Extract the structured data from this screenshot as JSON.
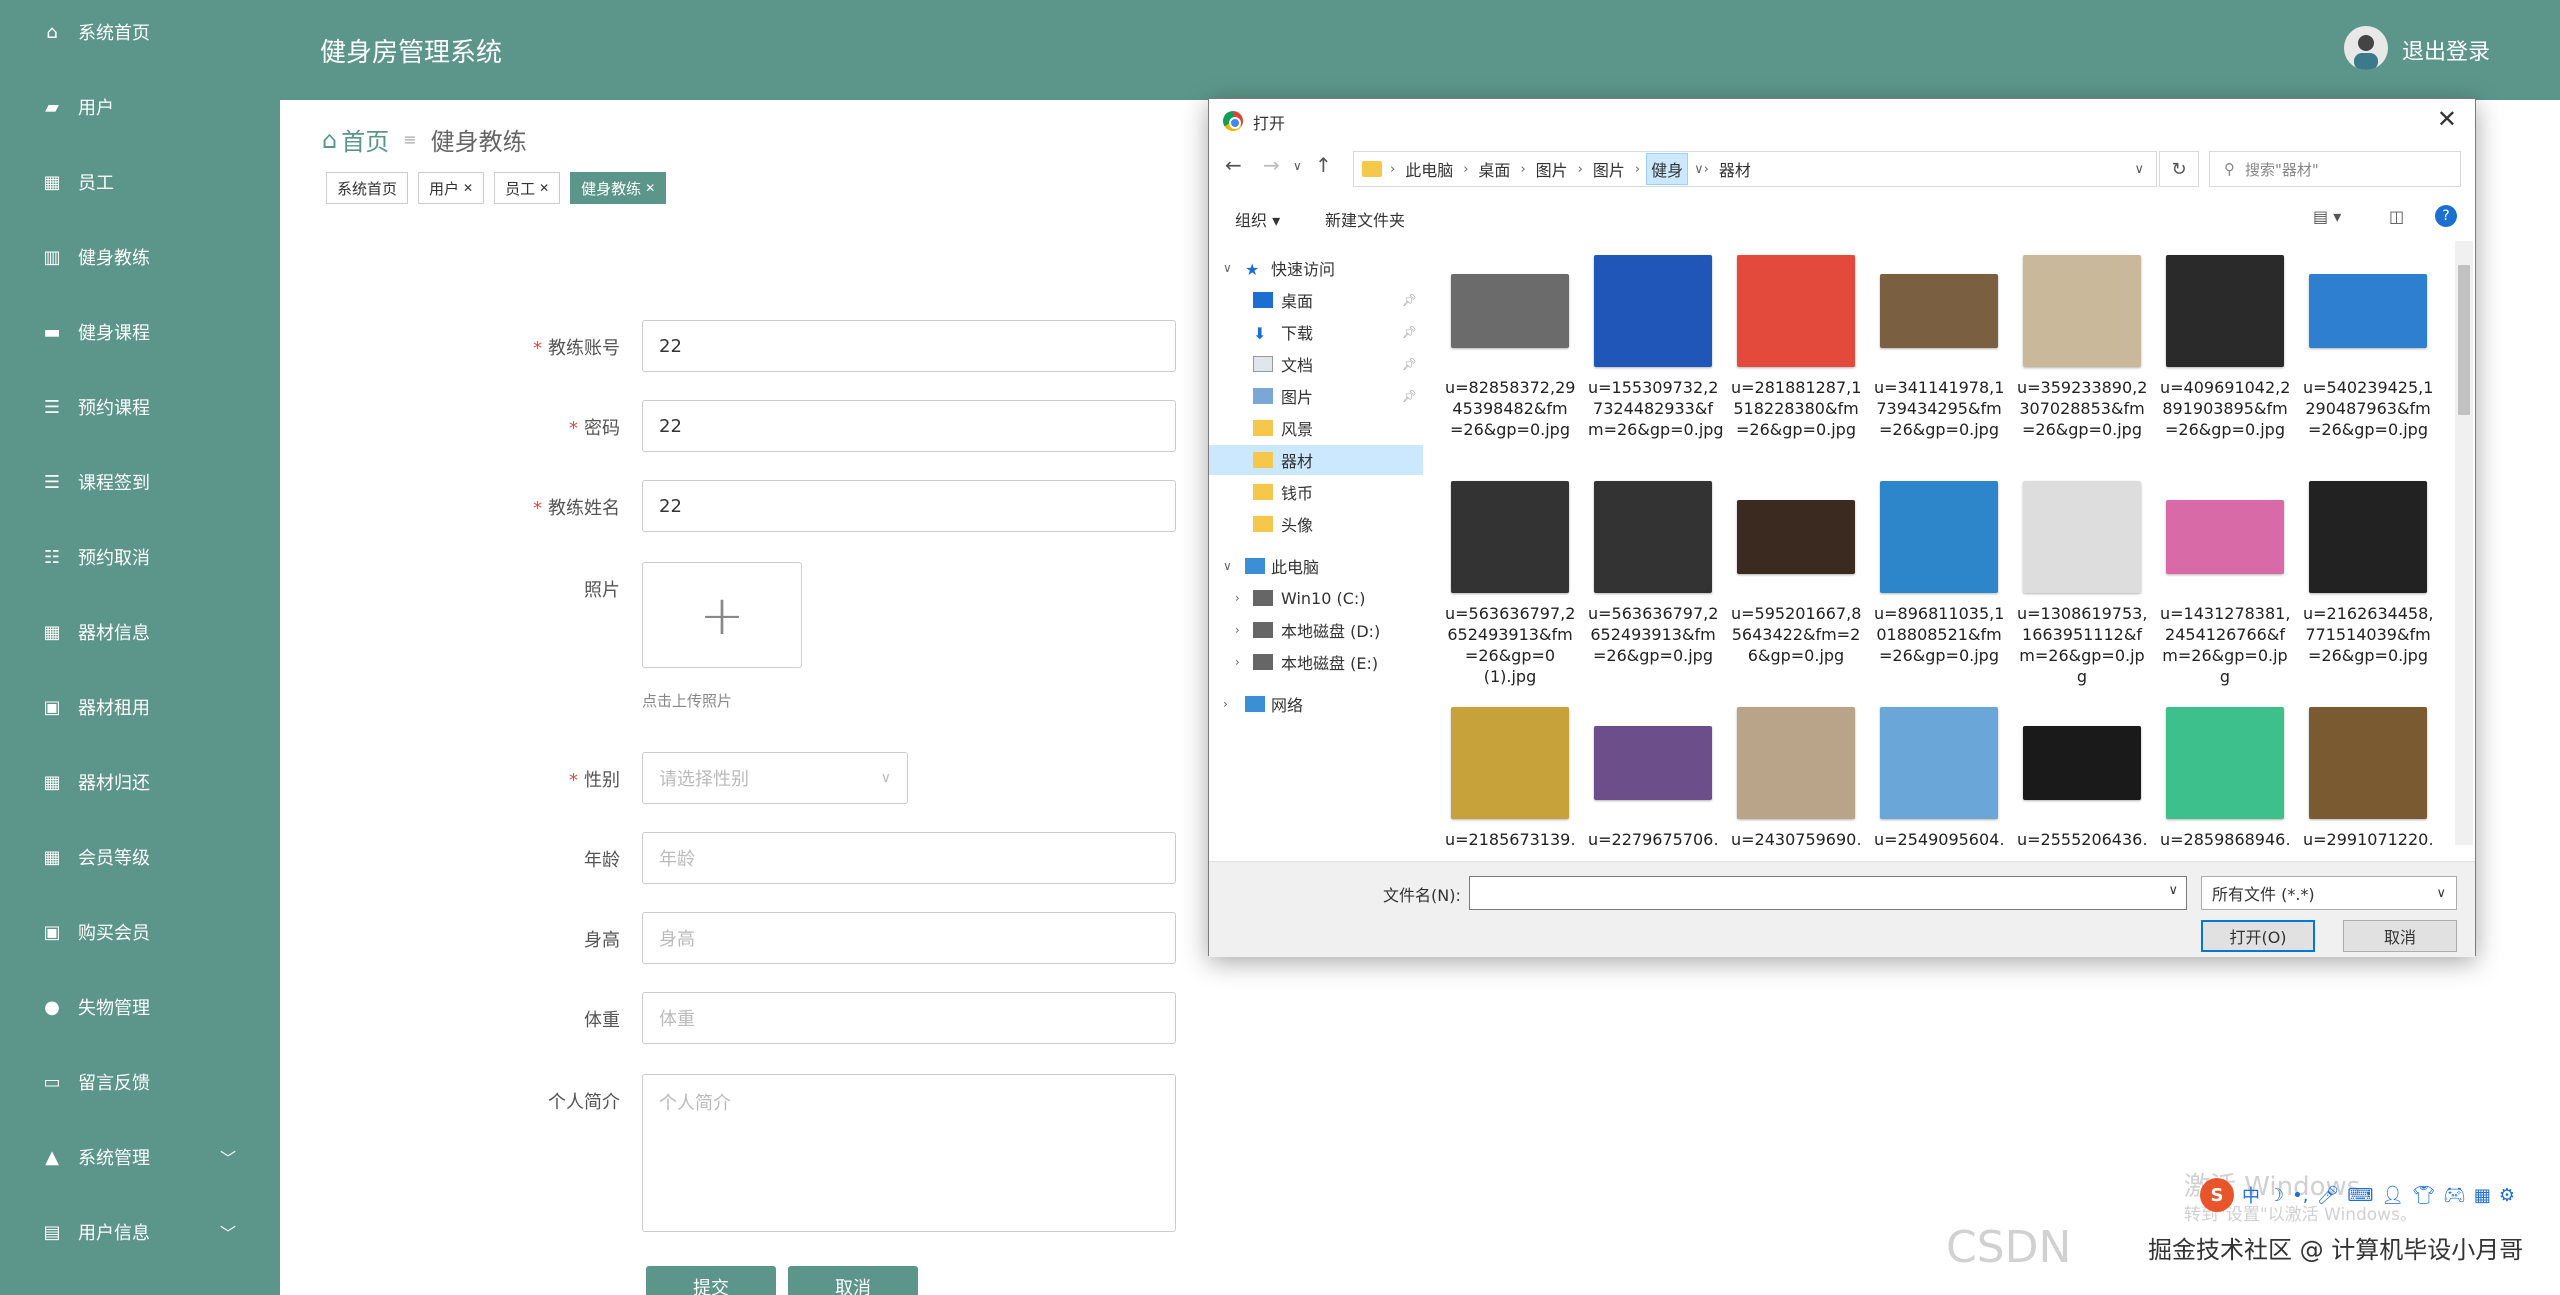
{
  "sidebar": {
    "items": [
      {
        "label": "系统首页",
        "icon": "home-icon"
      },
      {
        "label": "用户",
        "icon": "briefcase-icon"
      },
      {
        "label": "员工",
        "icon": "grid-icon"
      },
      {
        "label": "健身教练",
        "icon": "chart-icon"
      },
      {
        "label": "健身课程",
        "icon": "book-icon"
      },
      {
        "label": "预约课程",
        "icon": "list-icon"
      },
      {
        "label": "课程签到",
        "icon": "list-icon"
      },
      {
        "label": "预约取消",
        "icon": "sliders-icon"
      },
      {
        "label": "器材信息",
        "icon": "grid-icon"
      },
      {
        "label": "器材租用",
        "icon": "clipboard-icon"
      },
      {
        "label": "器材归还",
        "icon": "table-icon"
      },
      {
        "label": "会员等级",
        "icon": "grid-icon"
      },
      {
        "label": "购买会员",
        "icon": "clipboard-icon"
      },
      {
        "label": "失物管理",
        "icon": "bulb-icon"
      },
      {
        "label": "留言反馈",
        "icon": "monitor-icon"
      },
      {
        "label": "系统管理",
        "icon": "user-icon",
        "chevron": "﹀"
      },
      {
        "label": "用户信息",
        "icon": "id-card-icon",
        "chevron": "﹀"
      }
    ]
  },
  "header": {
    "title": "健身房管理系统",
    "logout": "退出登录"
  },
  "breadcrumb": {
    "home": "首页",
    "sep": "≡",
    "current": "健身教练"
  },
  "tabs": [
    {
      "label": "系统首页",
      "close": ""
    },
    {
      "label": "用户",
      "close": "✕"
    },
    {
      "label": "员工",
      "close": "✕"
    },
    {
      "label": "健身教练",
      "close": "✕"
    }
  ],
  "form": {
    "account_label": "教练账号",
    "account_value": "22",
    "password_label": "密码",
    "password_value": "22",
    "name_label": "教练姓名",
    "name_value": "22",
    "photo_label": "照片",
    "photo_plus": "+",
    "photo_hint": "点击上传照片",
    "gender_label": "性别",
    "gender_placeholder": "请选择性别",
    "age_label": "年龄",
    "age_placeholder": "年龄",
    "height_label": "身高",
    "height_placeholder": "身高",
    "weight_label": "体重",
    "weight_placeholder": "体重",
    "intro_label": "个人简介",
    "intro_placeholder": "个人简介",
    "required_mark": "*",
    "submit": "提交",
    "cancel": "取消"
  },
  "dialog": {
    "title": "打开",
    "path": [
      "此电脑",
      "桌面",
      "图片",
      "图片",
      "健身",
      "器材"
    ],
    "search_placeholder": "搜索\"器材\"",
    "organize": "组织 ▾",
    "new_folder": "新建文件夹",
    "tree": [
      {
        "label": "快速访问"
      },
      {
        "label": "桌面"
      },
      {
        "label": "下载"
      },
      {
        "label": "文档"
      },
      {
        "label": "图片"
      },
      {
        "label": "风景"
      },
      {
        "label": "器材"
      },
      {
        "label": "钱币"
      },
      {
        "label": "头像"
      },
      {
        "label": "此电脑"
      },
      {
        "label": "Win10 (C:)"
      },
      {
        "label": "本地磁盘 (D:)"
      },
      {
        "label": "本地磁盘 (E:)"
      },
      {
        "label": "网络"
      }
    ],
    "files": [
      {
        "name": "u=82858372,2945398482&fm=26&gp=0.jpg",
        "lines": [
          "u=82858372,29",
          "45398482&fm",
          "=26&gp=0.jpg"
        ],
        "color": "#6b6b6b"
      },
      {
        "name": "u=155309732,27324482933&fm=26&gp=0.jpg",
        "lines": [
          "u=155309732,2",
          "7324482933&f",
          "m=26&gp=0.jpg"
        ],
        "color": "#1f56b8"
      },
      {
        "name": "u=281881287,15182283808&fm=26&gp=0.jpg",
        "lines": [
          "u=281881287,1",
          "518228380&fm",
          "=26&gp=0.jpg"
        ],
        "color": "#e34a3c"
      },
      {
        "name": "u=341141978,17394342958&fm=26&gp=0.jpg",
        "lines": [
          "u=341141978,1",
          "739434295&fm",
          "=26&gp=0.jpg"
        ],
        "color": "#7a6040"
      },
      {
        "name": "u=359233890,23070288538&fm=26&gp=0.jpg",
        "lines": [
          "u=359233890,2",
          "307028853&fm",
          "=26&gp=0.jpg"
        ],
        "color": "#c9b99a"
      },
      {
        "name": "u=409691042,28919038958&fm=26&gp=0.jpg",
        "lines": [
          "u=409691042,2",
          "891903895&fm",
          "=26&gp=0.jpg"
        ],
        "color": "#2a2a2a"
      },
      {
        "name": "u=540239425,12904878963&fm=26&gp=0.jpg",
        "lines": [
          "u=540239425,1",
          "290487963&fm",
          "=26&gp=0.jpg"
        ],
        "color": "#2f7fd1"
      },
      {
        "name": "u=563636797,26524939138&fm=26&gp=0(1).jpg",
        "lines": [
          "u=563636797,2",
          "652493913&fm",
          "=26&gp=0",
          "(1).jpg"
        ],
        "color": "#333333"
      },
      {
        "name": "u=563636797,26524939138&fm=26&gp=0.jpg",
        "lines": [
          "u=563636797,2",
          "652493913&fm",
          "=26&gp=0.jpg"
        ],
        "color": "#333333"
      },
      {
        "name": "u=595201667,85643422&fm=26&gp=0.jpg",
        "lines": [
          "u=595201667,8",
          "5643422&fm=2",
          "6&gp=0.jpg"
        ],
        "color": "#3a2a20"
      },
      {
        "name": "u=896811035,10188085218&fm=26&gp=0.jpg",
        "lines": [
          "u=896811035,1",
          "018808521&fm",
          "=26&gp=0.jpg"
        ],
        "color": "#2c86c9"
      },
      {
        "name": "u=1308619753,16639511128&fm=26&gp=0.jpg",
        "lines": [
          "u=1308619753,",
          "1663951112&f",
          "m=26&gp=0.jp",
          "g"
        ],
        "color": "#dddddd"
      },
      {
        "name": "u=1431278381,24541267668&fm=26&gp=0.jpg",
        "lines": [
          "u=1431278381,",
          "2454126766&f",
          "m=26&gp=0.jp",
          "g"
        ],
        "color": "#d86aa8"
      },
      {
        "name": "u=2162634458,77151403968&fm=26&gp=0.jpg",
        "lines": [
          "u=2162634458,",
          "771514039&fm",
          "=26&gp=0.jpg"
        ],
        "color": "#222222"
      },
      {
        "name": "u=2185673139,1962253289&f",
        "lines": [
          "u=2185673139,",
          "1962253289&f"
        ],
        "color": "#c7a23a"
      },
      {
        "name": "u=2279675706,4056733548&f",
        "lines": [
          "u=2279675706,",
          "4056733548&f"
        ],
        "color": "#6b4e8a"
      },
      {
        "name": "u=2430759690,1157824097&f",
        "lines": [
          "u=2430759690,",
          "1157824097&f"
        ],
        "color": "#b9a48a"
      },
      {
        "name": "u=2549095604,2340526555&f",
        "lines": [
          "u=2549095604,",
          "2340526555&f"
        ],
        "color": "#6aa7d8"
      },
      {
        "name": "u=2555206436,1712832647&f",
        "lines": [
          "u=2555206436,",
          "1712832647&f"
        ],
        "color": "#1a1a1a"
      },
      {
        "name": "u=2859868946,2452975798&f",
        "lines": [
          "u=2859868946,",
          "2452975798&f"
        ],
        "color": "#3ec08c"
      },
      {
        "name": "u=2991071220,2128066744&f",
        "lines": [
          "u=2991071220,",
          "2128066744&f"
        ],
        "color": "#7a5a30"
      }
    ],
    "filename_label": "文件名(N):",
    "filetype": "所有文件 (*.*)",
    "open": "打开(O)",
    "cancel": "取消"
  },
  "overlay": {
    "watermark_activate": "激活 Windows",
    "watermark_sub": "转到\"设置\"以激活 Windows。",
    "csdn": "CSDN",
    "footer": "掘金技术社区 @ 计算机毕设小月哥"
  }
}
